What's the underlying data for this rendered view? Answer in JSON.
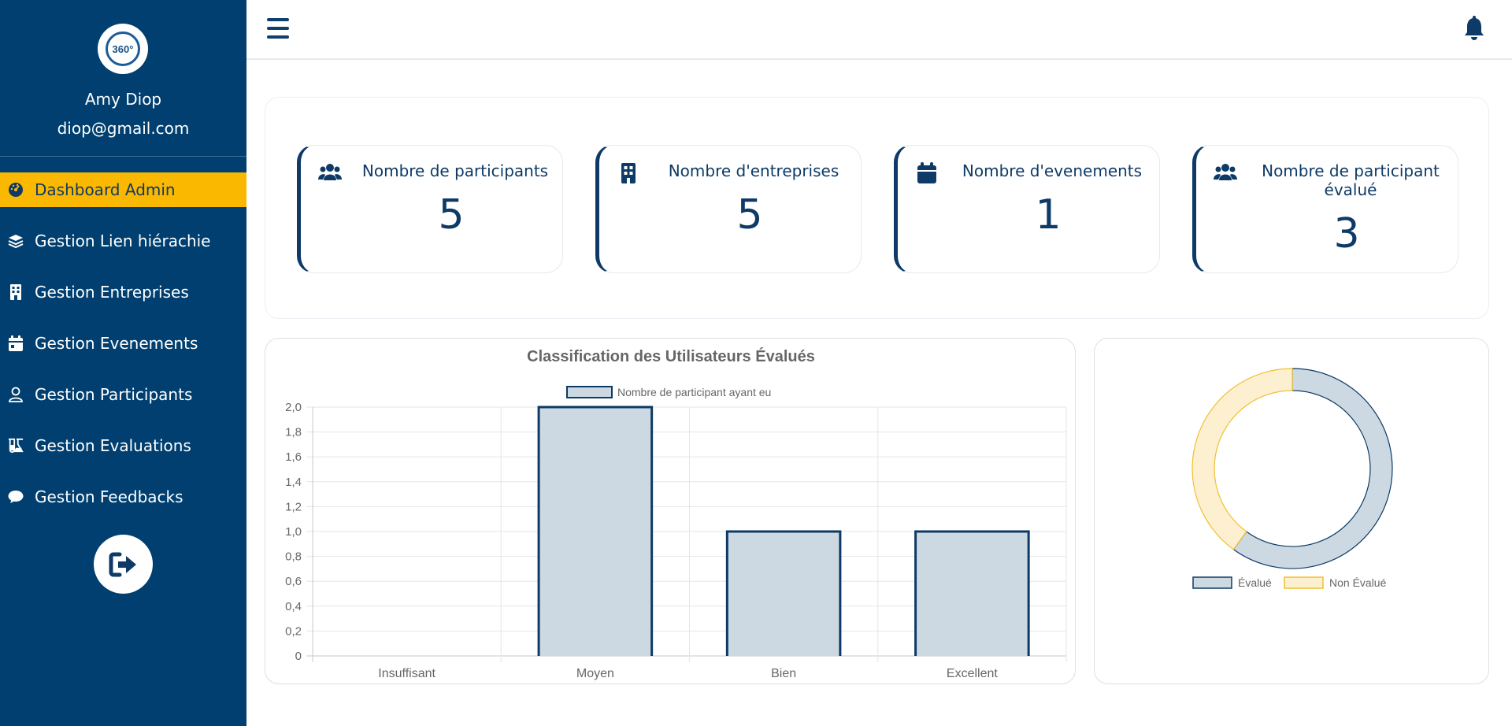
{
  "profile": {
    "logo_text": "360°",
    "name": "Amy Diop",
    "email": "diop@gmail.com"
  },
  "sidebar": {
    "items": [
      {
        "label": "Dashboard Admin",
        "icon": "gauge-icon",
        "active": true
      },
      {
        "label": "Gestion Lien hiérachie",
        "icon": "layers-icon",
        "active": false
      },
      {
        "label": "Gestion Entreprises",
        "icon": "building-icon",
        "active": false
      },
      {
        "label": "Gestion Evenements",
        "icon": "calendar-icon",
        "active": false
      },
      {
        "label": "Gestion Participants",
        "icon": "user-icon",
        "active": false
      },
      {
        "label": "Gestion Evaluations",
        "icon": "flask-icon",
        "active": false
      },
      {
        "label": "Gestion Feedbacks",
        "icon": "comment-icon",
        "active": false
      }
    ],
    "logout_icon": "sign-out-icon"
  },
  "topbar": {
    "menu_icon": "hamburger-icon",
    "notification_icon": "bell-icon"
  },
  "stats": [
    {
      "title": "Nombre de participants",
      "value": "5",
      "icon": "users-icon"
    },
    {
      "title": "Nombre d'entreprises",
      "value": "5",
      "icon": "building-icon"
    },
    {
      "title": "Nombre d'evenements",
      "value": "1",
      "icon": "calendar-icon"
    },
    {
      "title": "Nombre de participant évalué",
      "value": "3",
      "icon": "users-icon"
    }
  ],
  "colors": {
    "sidebar": "#003f6f",
    "accent": "#fbb800",
    "primary": "#0d3a66",
    "bar_fill": "#ccd9e3",
    "donut_eval": "#ccd9e3",
    "donut_non_eval": "#fdf0d0",
    "donut_non_eval_stroke": "#f0c030"
  },
  "chart_data": [
    {
      "type": "bar",
      "title": "Classification des Utilisateurs Évalués",
      "categories": [
        "Insuffisant",
        "Moyen",
        "Bien",
        "Excellent"
      ],
      "series": [
        {
          "name": "Nombre de participant ayant eu",
          "values": [
            0,
            2,
            1,
            1
          ]
        }
      ],
      "ylim": [
        0,
        2
      ],
      "yticks": [
        "0",
        "0,2",
        "0,4",
        "0,6",
        "0,8",
        "1,0",
        "1,2",
        "1,4",
        "1,6",
        "1,8",
        "2,0"
      ],
      "grid": true,
      "legend": "top"
    },
    {
      "type": "pie",
      "donut": true,
      "labels": [
        "Évalué",
        "Non Évalué"
      ],
      "values": [
        3,
        2
      ],
      "legend": "bottom"
    }
  ]
}
